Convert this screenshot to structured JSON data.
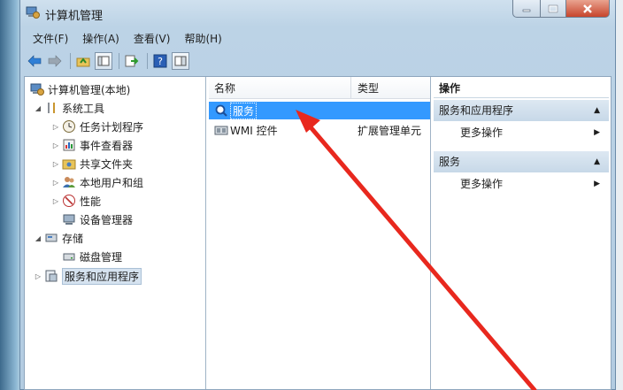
{
  "window": {
    "title": "计算机管理"
  },
  "menubar": [
    "文件(F)",
    "操作(A)",
    "查看(V)",
    "帮助(H)"
  ],
  "toolbar": {
    "buttons": [
      "back-icon",
      "forward-icon",
      "up-folder-icon",
      "show-tree-icon",
      "export-icon",
      "help-icon",
      "properties-icon"
    ]
  },
  "tree": {
    "root": "计算机管理(本地)",
    "system_tools": "系统工具",
    "task_scheduler": "任务计划程序",
    "event_viewer": "事件查看器",
    "shared_folders": "共享文件夹",
    "local_users": "本地用户和组",
    "performance": "性能",
    "device_manager": "设备管理器",
    "storage": "存储",
    "disk_management": "磁盘管理",
    "services_apps": "服务和应用程序"
  },
  "list": {
    "col_name": "名称",
    "col_type": "类型",
    "rows": [
      {
        "name": "服务",
        "type": ""
      },
      {
        "name": "WMI 控件",
        "type": "扩展管理单元"
      }
    ]
  },
  "actions": {
    "header": "操作",
    "section1": "服务和应用程序",
    "more1": "更多操作",
    "section2": "服务",
    "more2": "更多操作"
  },
  "colors": {
    "selection": "#3399ff",
    "annotation_arrow": "#e8281e"
  }
}
